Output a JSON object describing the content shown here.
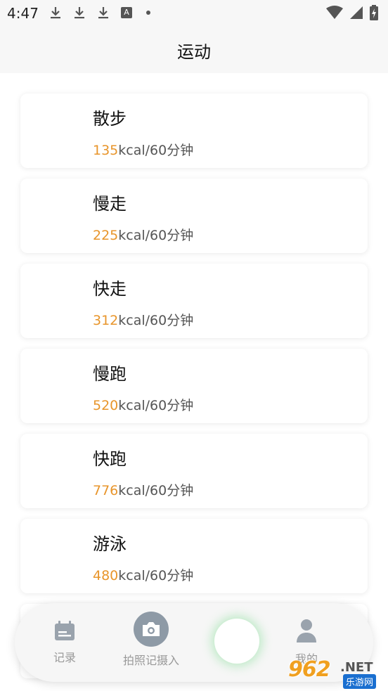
{
  "status_bar": {
    "time": "4:47",
    "a_badge": "A"
  },
  "header": {
    "title": "运动"
  },
  "exercises": [
    {
      "name": "散步",
      "kcal": "135",
      "unit": "kcal/60分钟"
    },
    {
      "name": "慢走",
      "kcal": "225",
      "unit": "kcal/60分钟"
    },
    {
      "name": "快走",
      "kcal": "312",
      "unit": "kcal/60分钟"
    },
    {
      "name": "慢跑",
      "kcal": "520",
      "unit": "kcal/60分钟"
    },
    {
      "name": "快跑",
      "kcal": "776",
      "unit": "kcal/60分钟"
    },
    {
      "name": "游泳",
      "kcal": "480",
      "unit": "kcal/60分钟"
    },
    {
      "name": "",
      "kcal": "",
      "unit": ""
    }
  ],
  "tab_bar": {
    "records_label": "记录",
    "photo_label": "拍照记摄入",
    "me_label": "我的"
  },
  "watermark": {
    "logo": "962",
    "net": ".NET",
    "cn": "乐游网"
  },
  "colors": {
    "accent_kcal": "#e8952b",
    "tab_icon": "#8e9aa6",
    "center_glow": "#78dc8c"
  }
}
